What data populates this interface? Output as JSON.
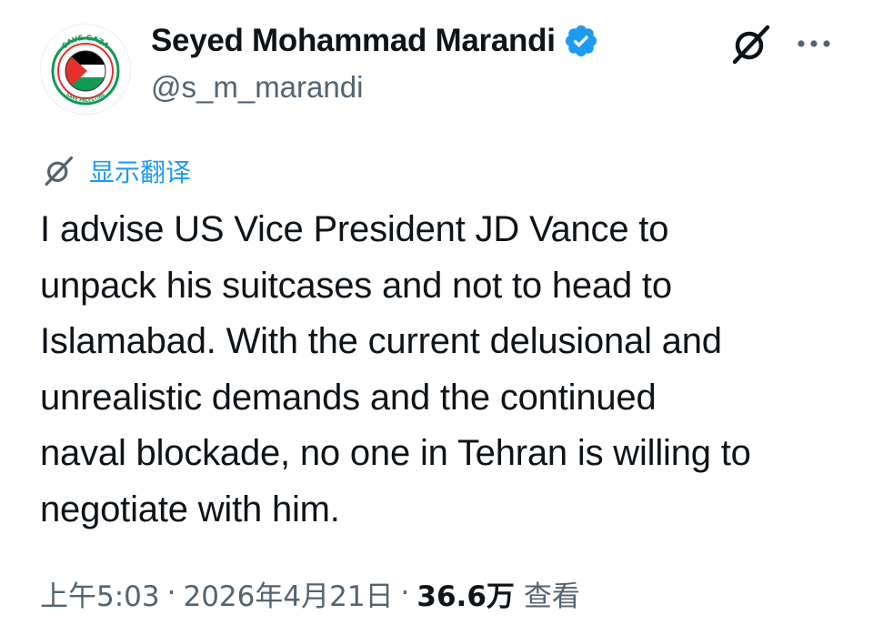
{
  "author": {
    "display_name": "Seyed Mohammad Marandi",
    "handle": "@s_m_marandi",
    "avatar_text_top": "SAVE GAZA",
    "avatar_text_bottom": "SAVE PALESTINE",
    "verified": true
  },
  "actions": {
    "grok_icon": "grok-icon",
    "more_icon": "more-horizontal-icon"
  },
  "translate": {
    "icon": "grok-icon",
    "label": "显示翻译"
  },
  "tweet": {
    "text": "I advise US Vice President JD Vance to\nunpack his suitcases and not to head to\nIslamabad. With the current delusional and\nunrealistic demands and the continued\nnaval blockade, no one in Tehran is willing to\nnegotiate with him."
  },
  "meta": {
    "time": "上午5:03",
    "separator": "·",
    "date": "2026年4月21日",
    "views_count": "36.6万",
    "views_label": "查看"
  },
  "colors": {
    "text_primary": "#0f1419",
    "text_secondary": "#536471",
    "link_blue": "#1d9bf0",
    "verified_blue": "#1d9bf0",
    "palestine_red": "#e4312b",
    "palestine_green": "#149954",
    "palestine_black": "#000000"
  }
}
